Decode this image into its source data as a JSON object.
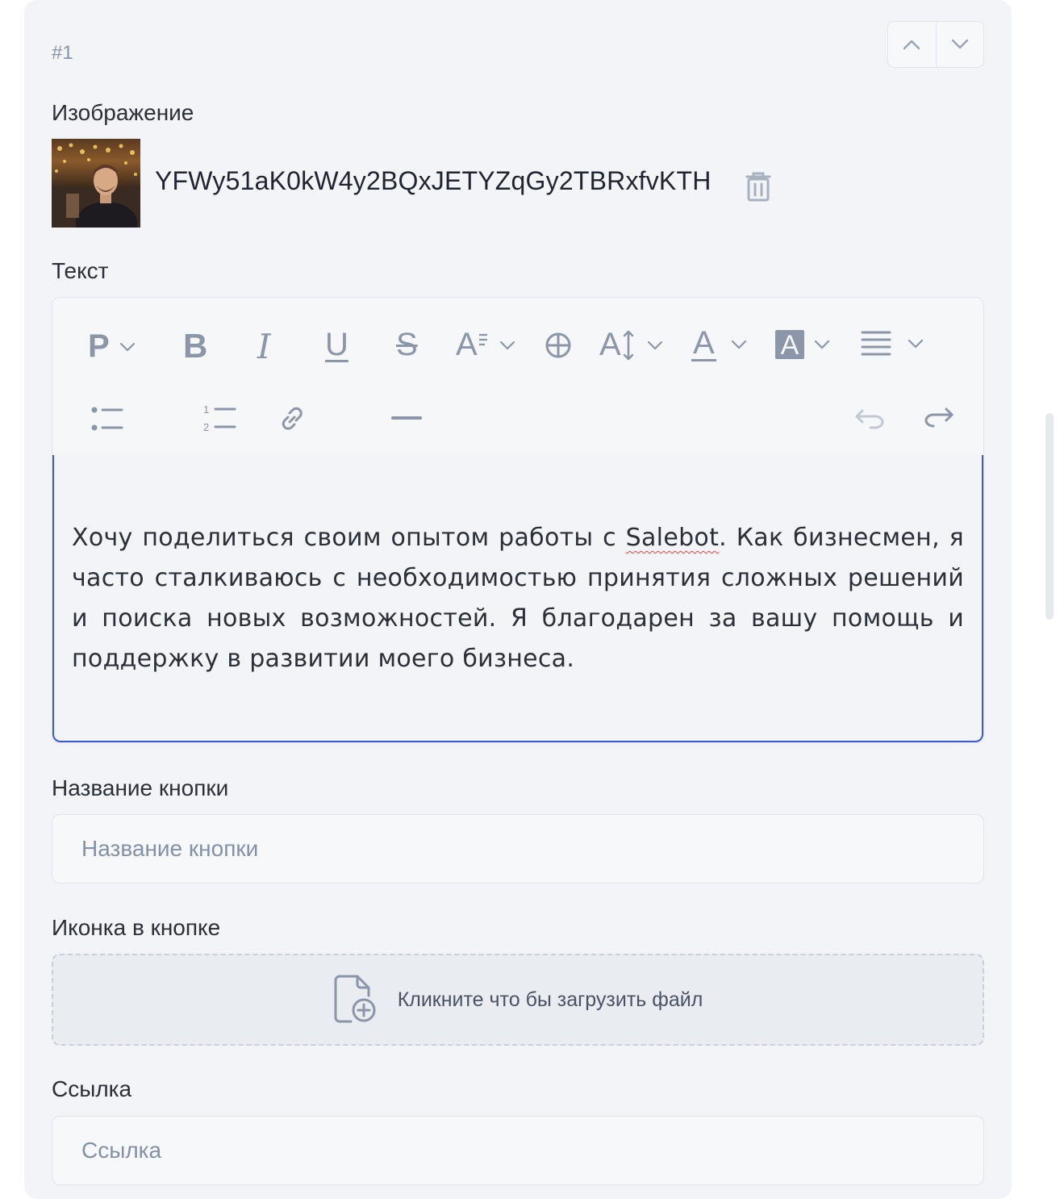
{
  "item": {
    "index_label": "#1",
    "move_up_icon": "chevron-up-icon",
    "move_down_icon": "chevron-down-icon"
  },
  "image_field": {
    "label": "Изображение",
    "file_name": "YFWy51aK0kW4y2BQxJETYZqGy2TBRxfvKTH",
    "delete_icon": "trash-icon"
  },
  "text_field": {
    "label": "Текст",
    "toolbar": {
      "paragraph_label": "P",
      "bold_label": "B",
      "italic_label": "I",
      "underline_label": "U",
      "strike_label": "S",
      "font_size_label": "A",
      "line_height_label": "A",
      "font_color_label": "A",
      "bg_color_label": "A",
      "icons": [
        "paragraph-format-icon",
        "bold-icon",
        "italic-icon",
        "underline-icon",
        "strikethrough-icon",
        "font-size-icon",
        "emoji-icon",
        "line-height-icon",
        "font-color-icon",
        "background-color-icon",
        "align-icon",
        "bullet-list-icon",
        "numbered-list-icon",
        "link-icon",
        "horizontal-rule-icon",
        "undo-icon",
        "redo-icon"
      ]
    },
    "content": {
      "part1": "Хочу поделиться своим опытом работы с ",
      "spell_word": "Salebot",
      "part2": ". Как бизнесмен, я часто сталкиваюсь с необходимостью принятия сложных решений и поиска новых возможностей. Я благодарен за вашу помощь и поддержку в развитии моего бизнеса."
    }
  },
  "button_name_field": {
    "label": "Название кнопки",
    "placeholder": "Название кнопки",
    "value": ""
  },
  "button_icon_field": {
    "label": "Иконка в кнопке",
    "upload_text": "Кликните что бы загрузить файл",
    "upload_icon": "file-add-icon"
  },
  "link_field": {
    "label": "Ссылка",
    "placeholder": "Ссылка",
    "value": ""
  },
  "colors": {
    "focus_border": "#3b5bcc",
    "icon_gray": "#8b96a8",
    "background": "#f3f4f7"
  }
}
